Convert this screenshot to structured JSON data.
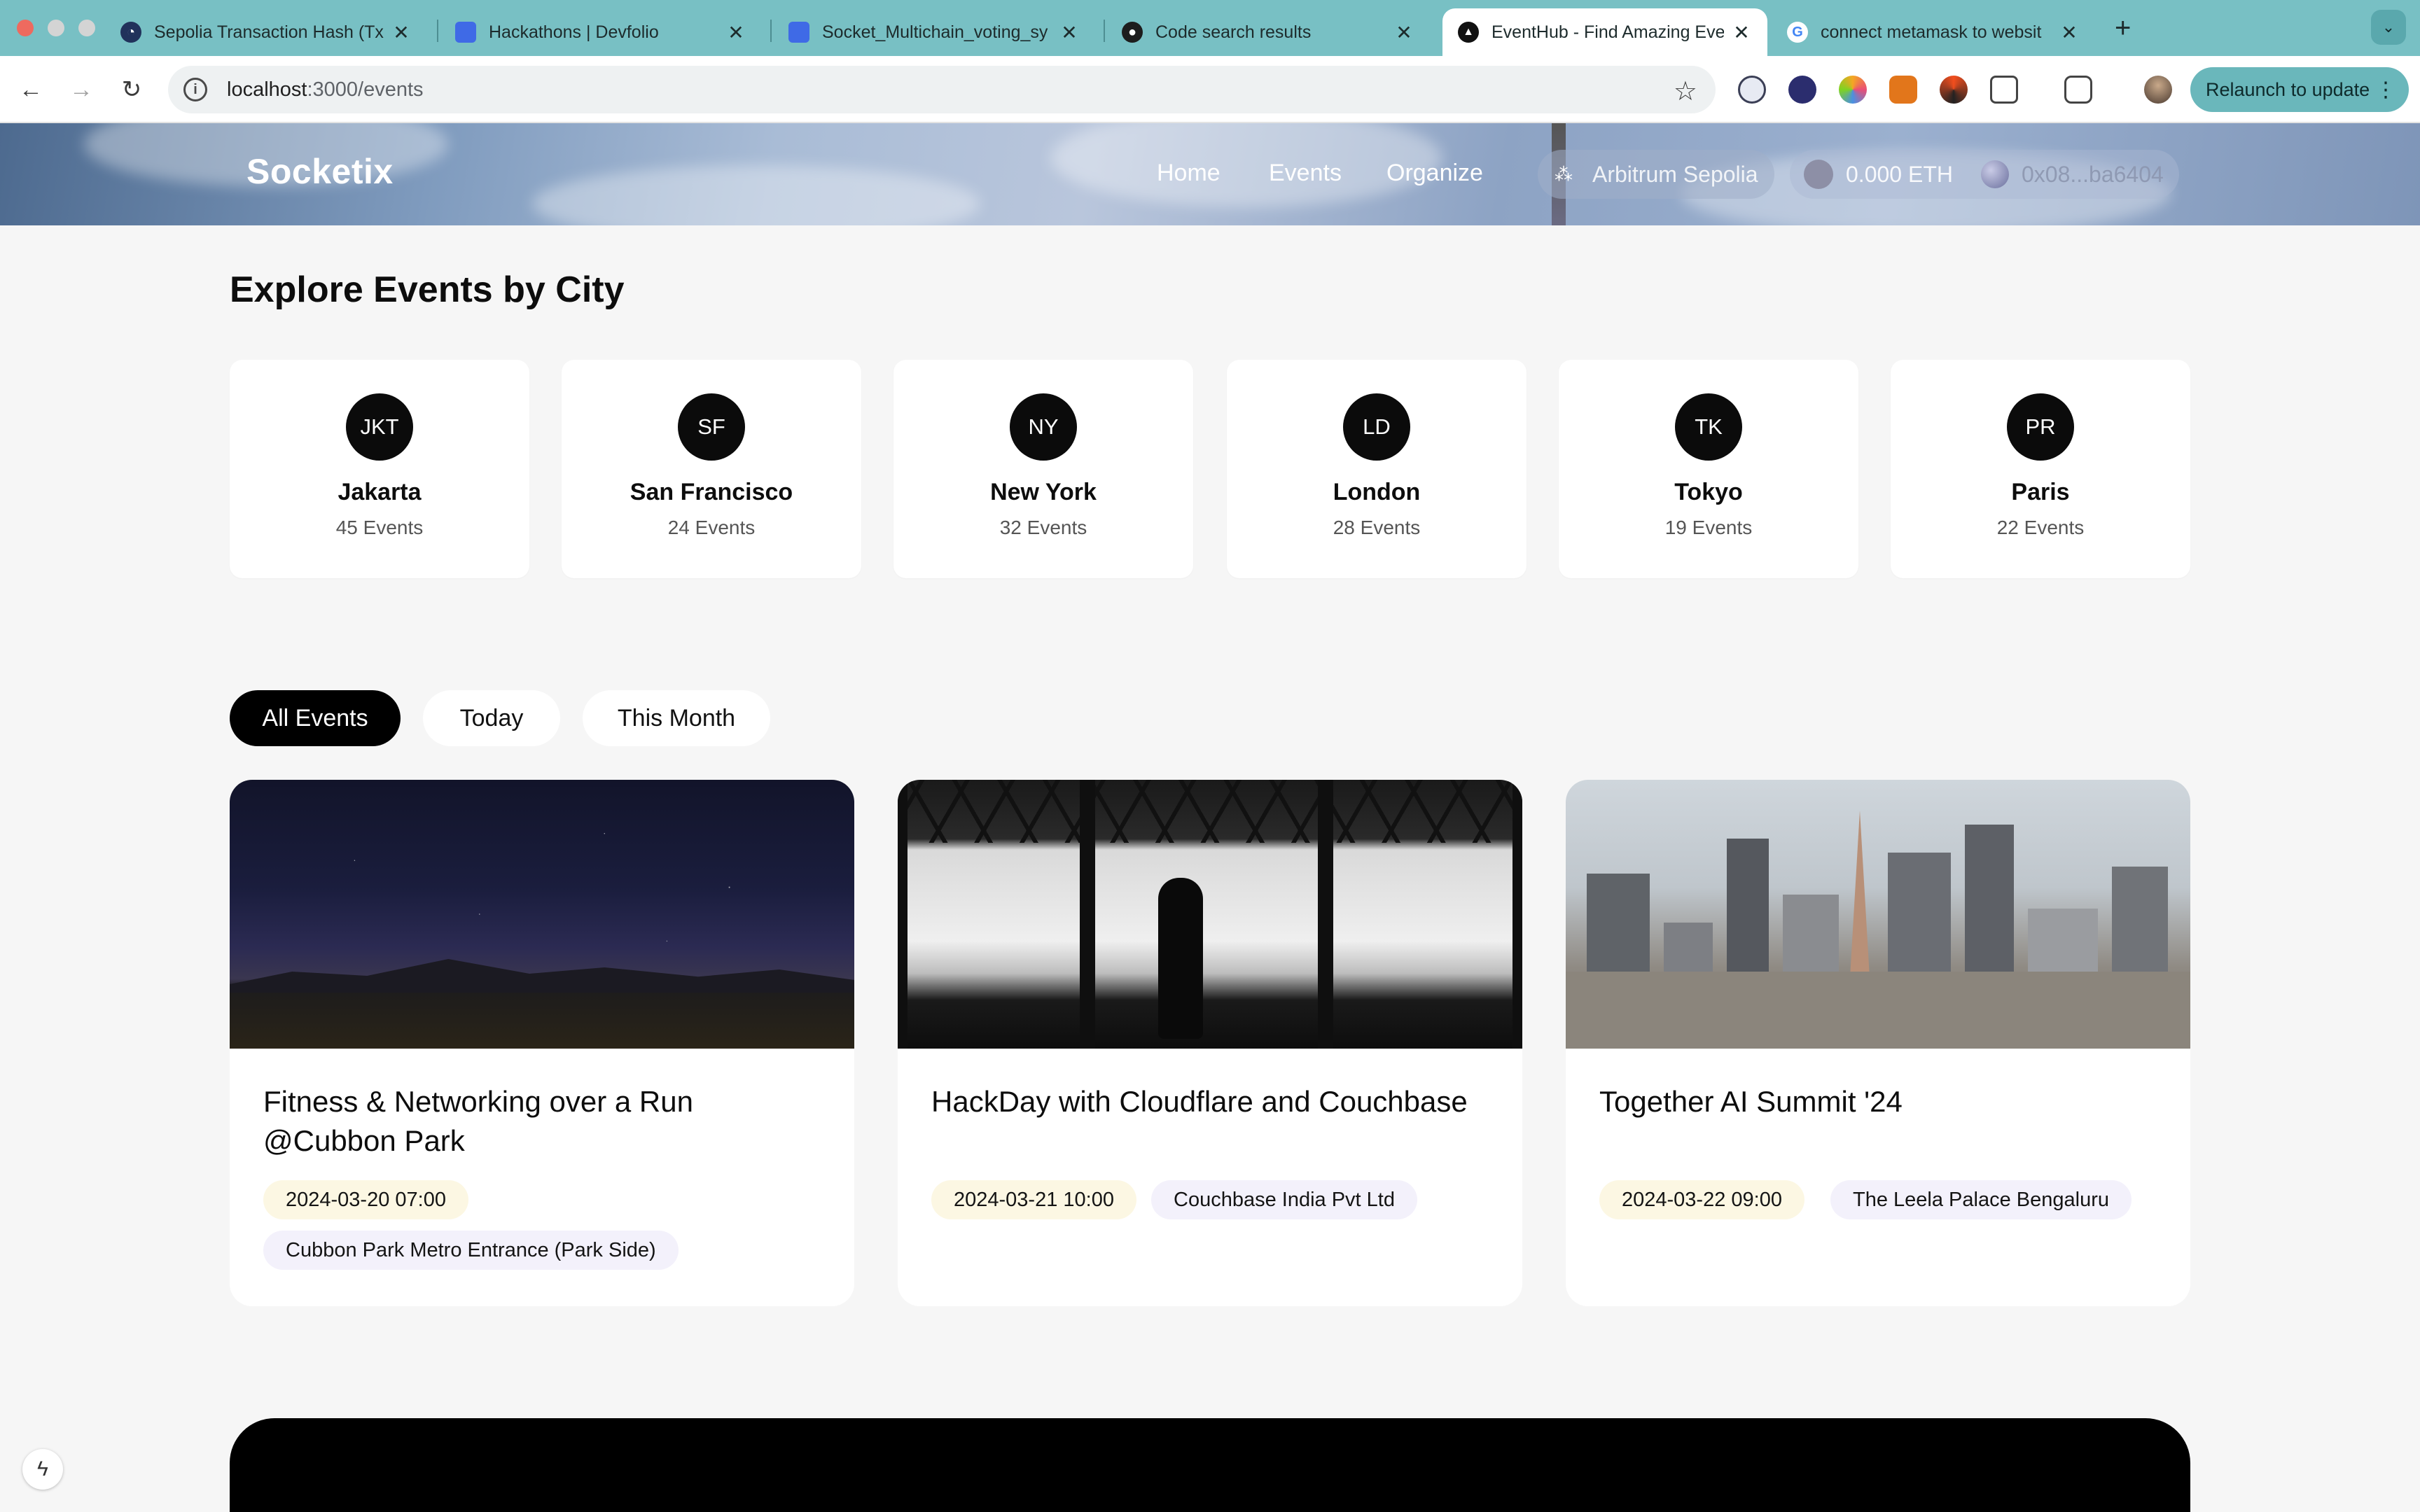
{
  "browser": {
    "tabs": [
      {
        "label": "Sepolia Transaction Hash (Txh",
        "icon": "etherscan-icon",
        "active": false
      },
      {
        "label": "Hackathons | Devfolio",
        "icon": "devfolio-icon",
        "active": false
      },
      {
        "label": "Socket_Multichain_voting_sy",
        "icon": "devfolio-icon",
        "active": false
      },
      {
        "label": "Code search results",
        "icon": "github-icon",
        "active": false
      },
      {
        "label": "EventHub - Find Amazing Eve",
        "icon": "nextjs-icon",
        "active": true
      },
      {
        "label": "connect metamask to websit",
        "icon": "google-icon",
        "active": false
      }
    ],
    "url_host": "localhost",
    "url_path": ":3000/events",
    "relaunch_label": "Relaunch to update"
  },
  "header": {
    "brand": "Socketix",
    "nav": [
      "Home",
      "Events",
      "Organize"
    ],
    "network": "Arbitrum Sepolia",
    "balance": "0.000 ETH",
    "address": "0x08...ba6404"
  },
  "cities": {
    "title": "Explore Events by City",
    "items": [
      {
        "code": "JKT",
        "name": "Jakarta",
        "count": "45 Events"
      },
      {
        "code": "SF",
        "name": "San Francisco",
        "count": "24 Events"
      },
      {
        "code": "NY",
        "name": "New York",
        "count": "32 Events"
      },
      {
        "code": "LD",
        "name": "London",
        "count": "28 Events"
      },
      {
        "code": "TK",
        "name": "Tokyo",
        "count": "19 Events"
      },
      {
        "code": "PR",
        "name": "Paris",
        "count": "22 Events"
      }
    ]
  },
  "filters": [
    "All Events",
    "Today",
    "This Month"
  ],
  "active_filter": "All Events",
  "events": [
    {
      "title": "Fitness & Networking over a Run @Cubbon Park",
      "date": "2024-03-20 07:00",
      "venue": "Cubbon Park Metro Entrance (Park Side)"
    },
    {
      "title": "HackDay with Cloudflare and Couchbase",
      "date": "2024-03-21 10:00",
      "venue": "Couchbase India Pvt Ltd"
    },
    {
      "title": "Together AI Summit '24",
      "date": "2024-03-22 09:00",
      "venue": "The Leela Palace Bengaluru"
    }
  ],
  "colors": {
    "tabbar": "#78c0c4",
    "accent_dark": "#000000",
    "date_chip": "#fcf7e3",
    "venue_chip": "#f3f1fb"
  }
}
